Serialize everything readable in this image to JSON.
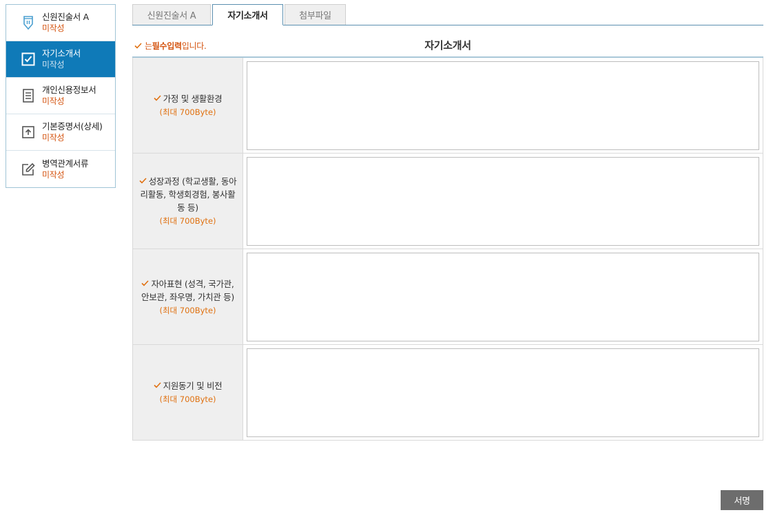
{
  "sidebar": {
    "items": [
      {
        "label": "신원진술서 A",
        "status": "미작성",
        "icon": "pen-icon",
        "active": false
      },
      {
        "label": "자기소개서",
        "status": "미작성",
        "icon": "checkbox-icon",
        "active": true
      },
      {
        "label": "개인신용정보서",
        "status": "미작성",
        "icon": "document-icon",
        "active": false
      },
      {
        "label": "기본증명서(상세)",
        "status": "미작성",
        "icon": "upload-icon",
        "active": false
      },
      {
        "label": "병역관계서류",
        "status": "미작성",
        "icon": "edit-icon",
        "active": false
      }
    ]
  },
  "tabs": [
    {
      "label": "신원진술서 A",
      "active": false
    },
    {
      "label": "자기소개서",
      "active": true
    },
    {
      "label": "첨부파일",
      "active": false
    }
  ],
  "required_note": {
    "prefix": "는 ",
    "emphasis": "필수입력",
    "suffix": "입니다."
  },
  "section_title": "자기소개서",
  "fields": [
    {
      "label": "가정 및 생활환경",
      "max": "(최대 700Byte)",
      "value": ""
    },
    {
      "label": "성장과정 (학교생활, 동아리활동, 학생회경험, 봉사활동 등)",
      "max": "(최대 700Byte)",
      "value": ""
    },
    {
      "label": "자아표현 (성격, 국가관, 안보관, 좌우명, 가치관 등)",
      "max": "(최대 700Byte)",
      "value": ""
    },
    {
      "label": "지원동기 및 비전",
      "max": "(최대 700Byte)",
      "value": ""
    }
  ],
  "sign_button": "서명",
  "colors": {
    "accent": "#0f7ab8",
    "status": "#d4530f",
    "check": "#e0700f"
  }
}
